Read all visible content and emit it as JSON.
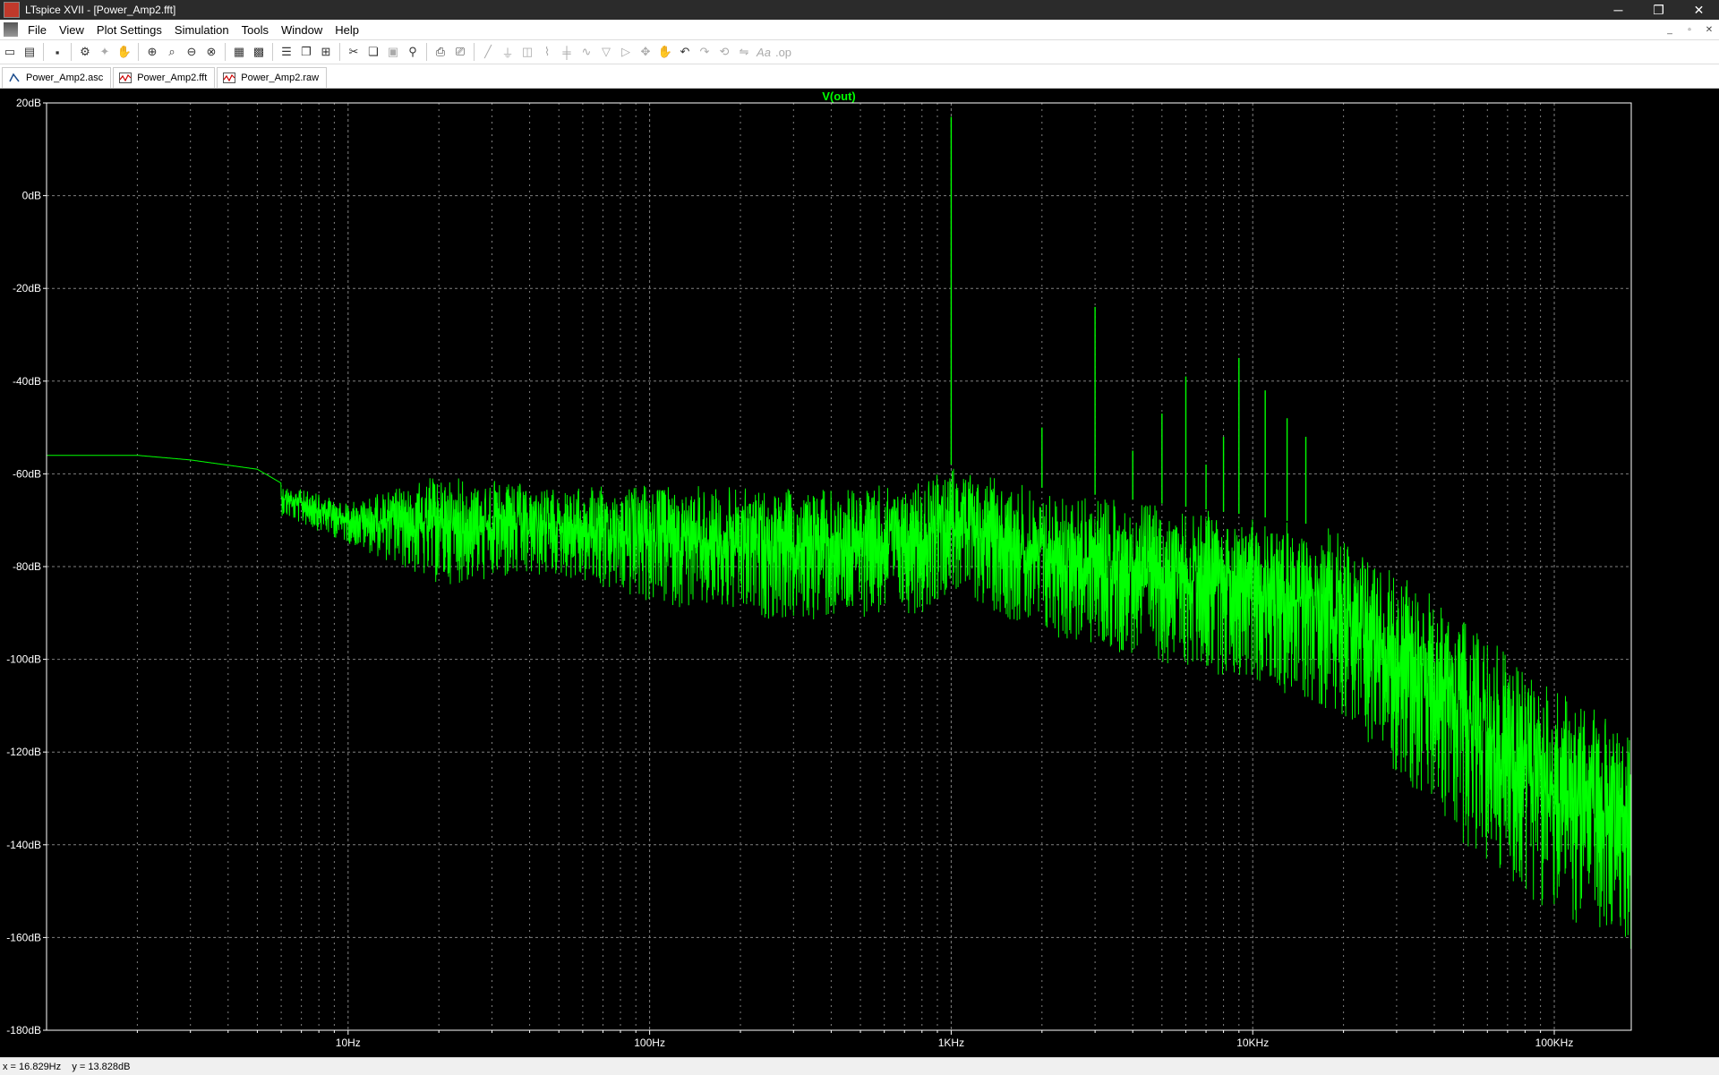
{
  "window": {
    "title": "LTspice XVII - [Power_Amp2.fft]",
    "buttons": [
      "─",
      "❐",
      "✕"
    ]
  },
  "menu": [
    "File",
    "View",
    "Plot Settings",
    "Simulation",
    "Tools",
    "Window",
    "Help"
  ],
  "mdi_controls": [
    "_",
    "▫",
    "✕"
  ],
  "toolbar": {
    "icons": [
      "new-icon",
      "open-icon",
      "save-icon",
      "control-panel-icon",
      "run-icon",
      "pan-icon",
      "zoom-in-icon",
      "zoom-area-icon",
      "zoom-out-icon",
      "zoom-fit-icon",
      "autorange-icon",
      "grid-icon",
      "tile-horizontal-icon",
      "cascade-icon",
      "tile-icon",
      "cut-icon",
      "copy-icon",
      "paste-icon",
      "find-icon",
      "print-icon",
      "print-preview-icon",
      "wire-icon",
      "ground-icon",
      "label-icon",
      "resistor-icon",
      "capacitor-icon",
      "inductor-icon",
      "diode-icon",
      "component-icon",
      "move-icon",
      "drag-icon",
      "undo-icon",
      "redo-icon",
      "rotate-icon",
      "mirror-icon",
      "text-icon",
      "spice-directive-icon"
    ]
  },
  "tabs": [
    {
      "label": "Power_Amp2.asc",
      "icon": "schematic-icon"
    },
    {
      "label": "Power_Amp2.fft",
      "icon": "waveform-icon"
    },
    {
      "label": "Power_Amp2.raw",
      "icon": "waveform-icon"
    }
  ],
  "status": {
    "text": "x = 16.829Hz    y = 13.828dB"
  },
  "colors": {
    "trace": "#00ff00",
    "background": "#000000",
    "grid": "#808080",
    "axis_text": "#ffffff"
  },
  "chart_data": {
    "type": "line",
    "title": "V(out)",
    "xscale": "log",
    "xlim": [
      1,
      180000
    ],
    "ylim": [
      -180,
      20
    ],
    "xticks": [
      "10Hz",
      "100Hz",
      "1KHz",
      "10KHz",
      "100KHz"
    ],
    "yticks": [
      "20dB",
      "0dB",
      "-20dB",
      "-40dB",
      "-60dB",
      "-80dB",
      "-100dB",
      "-120dB",
      "-140dB",
      "-160dB",
      "-180dB"
    ],
    "grid": true,
    "series": [
      {
        "name": "V(out)",
        "color": "#00ff00",
        "envelope": [
          {
            "f": 1,
            "top": -56,
            "bottom": -56
          },
          {
            "f": 2,
            "top": -56,
            "bottom": -56
          },
          {
            "f": 3,
            "top": -57,
            "bottom": -57
          },
          {
            "f": 5,
            "top": -59,
            "bottom": -61
          },
          {
            "f": 6,
            "top": -62,
            "bottom": -69
          },
          {
            "f": 10,
            "top": -66,
            "bottom": -75
          },
          {
            "f": 20,
            "top": -60,
            "bottom": -84
          },
          {
            "f": 50,
            "top": -63,
            "bottom": -82
          },
          {
            "f": 100,
            "top": -62,
            "bottom": -88
          },
          {
            "f": 300,
            "top": -63,
            "bottom": -92
          },
          {
            "f": 800,
            "top": -62,
            "bottom": -90
          },
          {
            "f": 1000,
            "top": -58,
            "bottom": -85
          },
          {
            "f": 2000,
            "top": -63,
            "bottom": -95
          },
          {
            "f": 10000,
            "top": -69,
            "bottom": -105
          },
          {
            "f": 20000,
            "top": -72,
            "bottom": -112
          },
          {
            "f": 30000,
            "top": -80,
            "bottom": -125
          },
          {
            "f": 60000,
            "top": -95,
            "bottom": -145
          },
          {
            "f": 100000,
            "top": -106,
            "bottom": -155
          },
          {
            "f": 180000,
            "top": -115,
            "bottom": -163
          }
        ],
        "peaks": [
          {
            "f": 1000,
            "db": 17
          },
          {
            "f": 2000,
            "db": -50
          },
          {
            "f": 3000,
            "db": -24
          },
          {
            "f": 4000,
            "db": -55
          },
          {
            "f": 5000,
            "db": -47
          },
          {
            "f": 6000,
            "db": -39
          },
          {
            "f": 7000,
            "db": -58
          },
          {
            "f": 8000,
            "db": -52
          },
          {
            "f": 9000,
            "db": -35
          },
          {
            "f": 11000,
            "db": -42
          },
          {
            "f": 13000,
            "db": -48
          },
          {
            "f": 15000,
            "db": -52
          }
        ]
      }
    ]
  }
}
